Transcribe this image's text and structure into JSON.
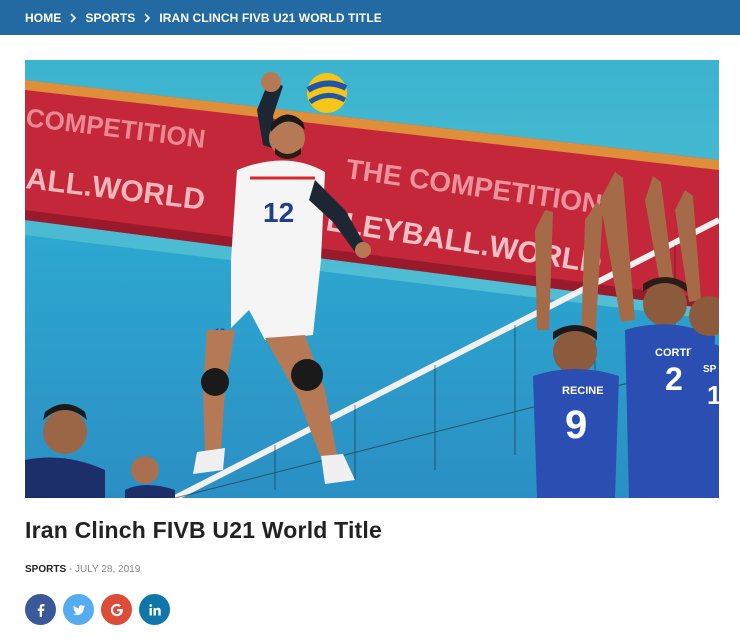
{
  "breadcrumb": {
    "items": [
      "HOME",
      "SPORTS",
      "IRAN CLINCH FIVB U21 WORLD TITLE"
    ]
  },
  "hero": {
    "banner_text_top": "COMPETITION",
    "banner_text_mid": "ALL.WORLD",
    "banner_text_right": "THE COMPETITION",
    "banner_text_right2": "LLEYBALL.WORLD",
    "player_jersey": "12",
    "player_short": "12",
    "blocker_left_name": "RECINE",
    "blocker_left_number": "9",
    "blocker_mid_name": "CORTESIA",
    "blocker_mid_number": "2",
    "blocker_right_name": "SP",
    "blocker_right_number": "1"
  },
  "article": {
    "title": "Iran Clinch FIVB U21 World Title",
    "category": "SPORTS",
    "date_prefix": " - ",
    "date": "JULY 28, 2019"
  },
  "share": [
    {
      "network": "facebook-icon",
      "glyph": "f",
      "color": "#3b5998"
    },
    {
      "network": "twitter-icon",
      "glyph": "t",
      "color": "#55acee"
    },
    {
      "network": "google-icon",
      "glyph": "G",
      "color": "#dd4b39"
    },
    {
      "network": "linkedin-icon",
      "glyph": "in",
      "color": "#0e76a8"
    }
  ]
}
